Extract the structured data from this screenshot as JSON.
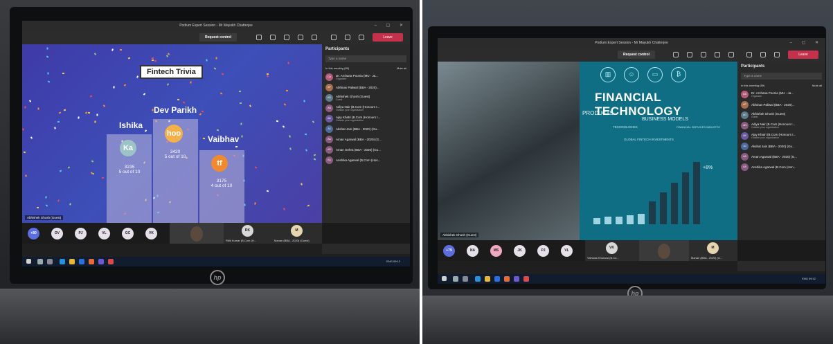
{
  "left_photo": {
    "window_title": "Podium Expert Session - Mr Mayukh Chatterjee",
    "toolbar": {
      "request_control": "Request control",
      "leave": "Leave"
    },
    "trivia": {
      "title": "Fintech Trivia",
      "podium": [
        {
          "name": "Ishika",
          "initials": "Ka",
          "score": "3235",
          "correct": "5 out of 10",
          "badge_color": "#9cc3c6"
        },
        {
          "name": "Dev Parikh",
          "initials": "hoo",
          "score": "3420",
          "correct": "5 out of 10",
          "badge_color": "#f4b04a"
        },
        {
          "name": "Vaibhav",
          "initials": "tf",
          "score": "3175",
          "correct": "4 out of 10",
          "badge_color": "#f08a2f"
        }
      ],
      "speaker_label": "Abhishek Ghosh (Guest)"
    },
    "participants": {
      "heading": "Participants",
      "search_placeholder": "Type a name",
      "in_meeting": "In this meeting (89)",
      "mute_all": "Mute all",
      "list": [
        {
          "initials": "DA",
          "name": "Dr. Archana Poonia (MU - Ja...",
          "sub": "Organizer",
          "color": "#b35c7a"
        },
        {
          "initials": "AP",
          "name": "Abhinav Paliwal (BBA - 2020)...",
          "sub": "",
          "color": "#a86e4e"
        },
        {
          "initials": "AG",
          "name": "Abhishek Ghosh (Guest)",
          "sub": "Guest",
          "color": "#5d7a8a"
        },
        {
          "initials": "AN",
          "name": "Adiya Nair (B.Com (Honours I...",
          "sub": "Outside your organization",
          "color": "#8b5a80"
        },
        {
          "initials": "AK",
          "name": "Ajay Khatri (B.Com (Honours I...",
          "sub": "Outside your organization",
          "color": "#6c5aa0"
        },
        {
          "initials": "AJ",
          "name": "Akshat Jain (BBA - 2020) (Gu...",
          "sub": "",
          "color": "#4e6a9a"
        },
        {
          "initials": "AA",
          "name": "Aman Agarwal (BBA - 2020) (G...",
          "sub": "",
          "color": "#8b5a80"
        },
        {
          "initials": "AG",
          "name": "Aman Gehra (BBA - 2020) (Gu...",
          "sub": "",
          "color": "#8b5a80"
        },
        {
          "initials": "AA",
          "name": "Anshika Agarwal (B.Com (Hon...",
          "sub": "",
          "color": "#8b5a80"
        }
      ]
    },
    "strip": {
      "circles": [
        {
          "label": "+80",
          "color": "#5b6ee0"
        },
        {
          "label": "DV",
          "color": "#e6e0ea"
        },
        {
          "label": "PJ",
          "color": "#e6e0ea"
        },
        {
          "label": "VL",
          "color": "#e6e0ea"
        },
        {
          "label": "GC",
          "color": "#e6e0ea"
        },
        {
          "label": "VK",
          "color": "#e6e0ea"
        }
      ],
      "tile_rk_initials": "RK",
      "tile_rk_name": "Ritik Kumar (B.Com (H... ",
      "tile_m_initials": "M",
      "tile_m_name": "Manan (BBA - 2020) (Guest)"
    },
    "taskbar_time": "ENG  09:12"
  },
  "right_photo": {
    "window_title": "Podium Expert Session - Mr Mayukh Chatterjee",
    "toolbar": {
      "request_control": "Request control",
      "leave": "Leave"
    },
    "slide": {
      "heading": "FINANCIAL TECHNOLOGY",
      "products": "PRODUCTS",
      "business_models": "BUSINESS MODELS",
      "technologies": "TECHNOLOGIES",
      "industry": "FINANCIAL SERVICES INDUSTRY",
      "chart_title": "GLOBAL FINTECH INVESTMENTS",
      "growth": "+8%",
      "icons": [
        "bank-icon",
        "people-icon",
        "card-icon",
        "bitcoin-icon"
      ],
      "bar_levels": [
        0.08,
        0.1,
        0.1,
        0.12,
        0.14,
        0.3,
        0.42,
        0.55,
        0.68,
        0.82
      ]
    },
    "speaker_label": "Abhishek Ghosh (Guest)",
    "participants": {
      "heading": "Participants",
      "search_placeholder": "Type a name",
      "in_meeting": "In this meeting (89)",
      "mute_all": "Mute all",
      "list": [
        {
          "initials": "DA",
          "name": "Dr. Archana Poonia (MU - Ja...",
          "sub": "Organizer",
          "color": "#b35c7a"
        },
        {
          "initials": "AP",
          "name": "Abhinav Paliwal (BBA - 2020)...",
          "sub": "",
          "color": "#a86e4e"
        },
        {
          "initials": "AG",
          "name": "Abhishek Ghosh (Guest)",
          "sub": "Guest",
          "color": "#5d7a8a"
        },
        {
          "initials": "AN",
          "name": "Adiya Nair (B.Com (Honours I...",
          "sub": "Outside your organization",
          "color": "#8b5a80"
        },
        {
          "initials": "AK",
          "name": "Ajay Khatri (B.Com (Honours I...",
          "sub": "Outside your organization",
          "color": "#6c5aa0"
        },
        {
          "initials": "AJ",
          "name": "Akshat Jain (BBA - 2020) (Gu...",
          "sub": "",
          "color": "#4e6a9a"
        },
        {
          "initials": "AA",
          "name": "Aman Agarwal (BBA - 2020) (G...",
          "sub": "",
          "color": "#8b5a80"
        },
        {
          "initials": "AA",
          "name": "Anshika Agarwal (B.Com (Hon...",
          "sub": "",
          "color": "#8b5a80"
        }
      ]
    },
    "strip": {
      "circles": [
        {
          "label": "+79",
          "color": "#5b6ee0"
        },
        {
          "label": "NA",
          "color": "#e6e0ea"
        },
        {
          "label": "MS",
          "color": "#f0a8c0"
        },
        {
          "label": "JK",
          "color": "#e6e0ea"
        },
        {
          "label": "PJ",
          "color": "#e6e0ea"
        },
        {
          "label": "VL",
          "color": "#e6e0ea"
        }
      ],
      "tile_vk_initials": "VK",
      "tile_vk_name": "Vishwas Khurana (B.Co...",
      "tile_m_initials": "M",
      "tile_m_name": "Manan (BBA - 2020) (G..."
    },
    "taskbar_time": "ENG  09:12"
  }
}
